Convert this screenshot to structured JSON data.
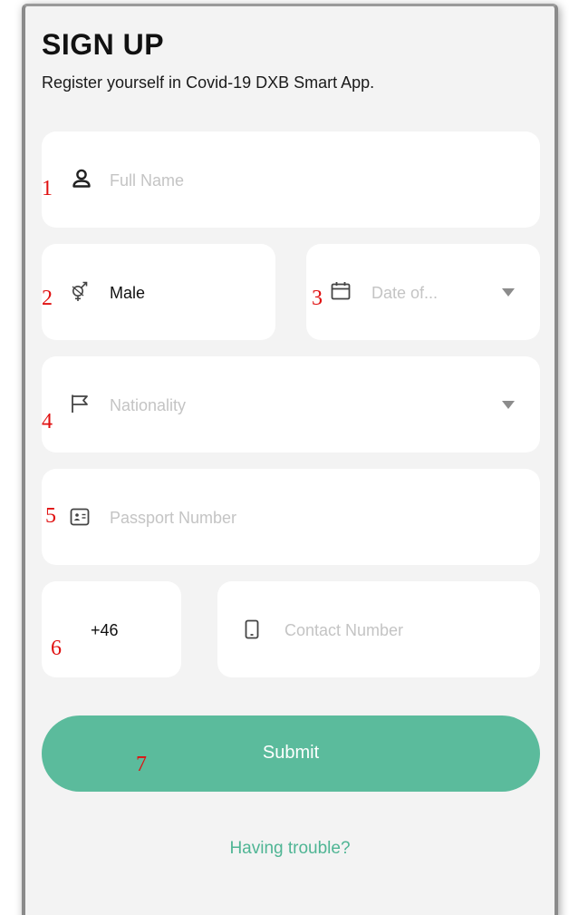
{
  "header": {
    "title": "SIGN UP",
    "subtitle": "Register yourself in Covid-19 DXB Smart App."
  },
  "form": {
    "full_name": {
      "placeholder": "Full Name",
      "icon": "user-icon"
    },
    "gender": {
      "value": "Male",
      "icon": "gender-icon"
    },
    "date_of_birth": {
      "placeholder": "Date of...",
      "icon": "calendar-icon"
    },
    "nationality": {
      "placeholder": "Nationality",
      "icon": "flag-icon"
    },
    "passport": {
      "placeholder": "Passport Number",
      "icon": "id-card-icon"
    },
    "country_code": {
      "value": "+46"
    },
    "contact": {
      "placeholder": "Contact Number",
      "icon": "mobile-phone-icon"
    },
    "submit_label": "Submit",
    "help_link": "Having trouble?"
  },
  "annotations": [
    "1",
    "2",
    "3",
    "4",
    "5",
    "6",
    "7"
  ],
  "colors": {
    "accent": "#5bbb9c",
    "link": "#4fb594",
    "annotation": "#e01010",
    "background": "#f3f3f3",
    "field": "#ffffff",
    "placeholder": "#c4c4c4"
  }
}
